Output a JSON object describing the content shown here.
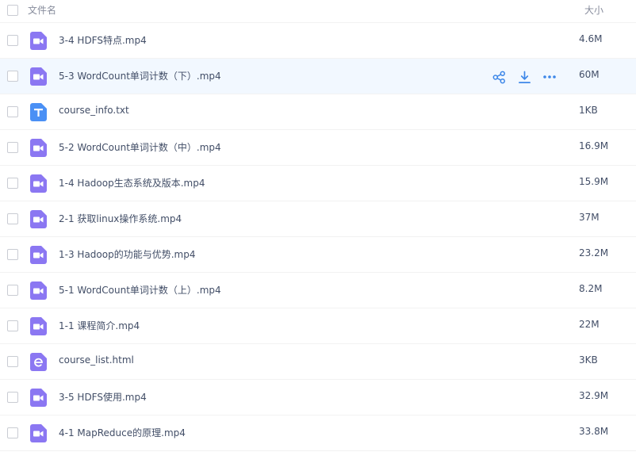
{
  "header": {
    "name_label": "文件名",
    "size_label": "大小"
  },
  "colors": {
    "video": "#8b77f2",
    "text": "#4a90f5",
    "html": "#8b77f2",
    "accent": "#3d87e8"
  },
  "files": [
    {
      "name": "3-4 HDFS特点.mp4",
      "size": "4.6M",
      "type": "video",
      "icon": "video-file-icon"
    },
    {
      "name": "5-3 WordCount单词计数（下）.mp4",
      "size": "60M",
      "type": "video",
      "icon": "video-file-icon"
    },
    {
      "name": "course_info.txt",
      "size": "1KB",
      "type": "text",
      "icon": "text-file-icon"
    },
    {
      "name": "5-2 WordCount单词计数（中）.mp4",
      "size": "16.9M",
      "type": "video",
      "icon": "video-file-icon"
    },
    {
      "name": "1-4 Hadoop生态系统及版本.mp4",
      "size": "15.9M",
      "type": "video",
      "icon": "video-file-icon"
    },
    {
      "name": "2-1 获取linux操作系统.mp4",
      "size": "37M",
      "type": "video",
      "icon": "video-file-icon"
    },
    {
      "name": "1-3 Hadoop的功能与优势.mp4",
      "size": "23.2M",
      "type": "video",
      "icon": "video-file-icon"
    },
    {
      "name": "5-1 WordCount单词计数（上）.mp4",
      "size": "8.2M",
      "type": "video",
      "icon": "video-file-icon"
    },
    {
      "name": "1-1 课程简介.mp4",
      "size": "22M",
      "type": "video",
      "icon": "video-file-icon"
    },
    {
      "name": "course_list.html",
      "size": "3KB",
      "type": "html",
      "icon": "html-file-icon"
    },
    {
      "name": "3-5 HDFS使用.mp4",
      "size": "32.9M",
      "type": "video",
      "icon": "video-file-icon"
    },
    {
      "name": "4-1 MapReduce的原理.mp4",
      "size": "33.8M",
      "type": "video",
      "icon": "video-file-icon"
    }
  ],
  "row_actions": {
    "share_icon": "share-icon",
    "download_icon": "download-icon",
    "more_icon": "more-icon"
  }
}
